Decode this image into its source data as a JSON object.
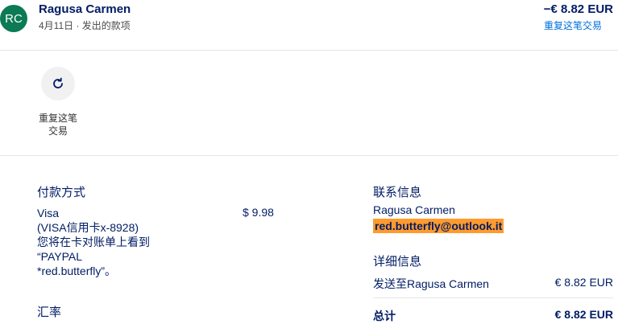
{
  "header": {
    "avatar_initials": "RC",
    "name": "Ragusa Carmen",
    "subtitle": "4月11日 · 发出的款项",
    "amount": "−€ 8.82 EUR",
    "repeat_link": "重复这笔交易"
  },
  "actions": {
    "repeat_label_line1": "重复这笔",
    "repeat_label_line2": "交易",
    "repeat_icon": "refresh-icon"
  },
  "payment": {
    "title": "付款方式",
    "lines": [
      "Visa",
      "(VISA信用卡x-8928)",
      "您将在卡对账单上看到",
      "“PAYPAL",
      "*red.butterfly”。"
    ],
    "amount": "$ 9.98",
    "exchange_title": "汇率"
  },
  "contact": {
    "title": "联系信息",
    "name": "Ragusa Carmen",
    "email": "red.butterfly@outlook.it"
  },
  "details": {
    "title": "详细信息",
    "sent_label": "发送至Ragusa Carmen",
    "sent_value": "€ 8.82 EUR",
    "total_label": "总计",
    "total_value": "€ 8.82 EUR"
  },
  "colors": {
    "avatar_bg": "#0b7a55",
    "link": "#0070e0",
    "text": "#001c64",
    "highlight": "#ff9a2e"
  }
}
